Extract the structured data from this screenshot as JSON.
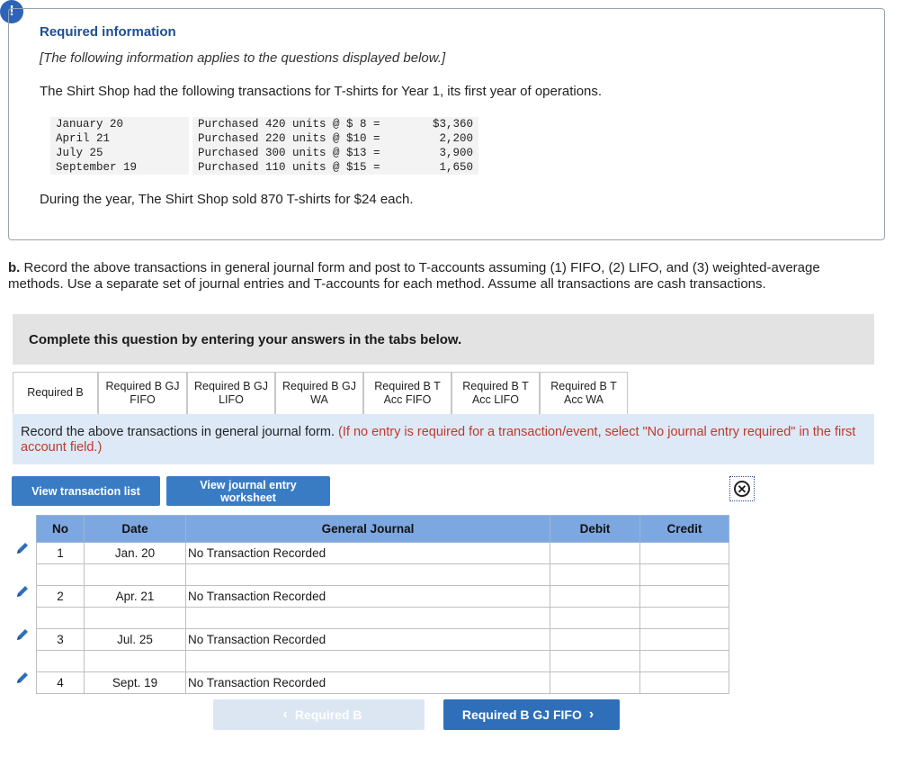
{
  "alert_icon": "!",
  "info": {
    "title": "Required information",
    "subtitle": "[The following information applies to the questions displayed below.]",
    "intro": "The Shirt Shop had the following transactions for T-shirts for Year 1, its first year of operations.",
    "transactions": [
      {
        "date": "January 20",
        "desc": "Purchased 420 units @ $ 8 =",
        "amount": "$3,360"
      },
      {
        "date": "April 21",
        "desc": "Purchased 220 units @ $10 =",
        "amount": "2,200"
      },
      {
        "date": "July 25",
        "desc": "Purchased 300 units @ $13 =",
        "amount": "3,900"
      },
      {
        "date": "September 19",
        "desc": "Purchased 110 units @ $15 =",
        "amount": "1,650"
      }
    ],
    "sold": "During the year, The Shirt Shop sold 870 T-shirts for $24 each."
  },
  "question": {
    "label": "b.",
    "text": "Record the above transactions in general journal form and post to T-accounts assuming (1) FIFO, (2) LIFO, and (3) weighted-average methods. Use a separate set of journal entries and T-accounts for each method. Assume all transactions are cash transactions."
  },
  "complete_banner": "Complete this question by entering your answers in the tabs below.",
  "tabs": [
    {
      "l1": "Required B",
      "l2": ""
    },
    {
      "l1": "Required B GJ",
      "l2": "FIFO"
    },
    {
      "l1": "Required B GJ",
      "l2": "LIFO"
    },
    {
      "l1": "Required B GJ",
      "l2": "WA"
    },
    {
      "l1": "Required B T",
      "l2": "Acc FIFO"
    },
    {
      "l1": "Required B T",
      "l2": "Acc LIFO"
    },
    {
      "l1": "Required B T",
      "l2": "Acc WA"
    }
  ],
  "instruction": {
    "main": "Record the above transactions in general journal form.",
    "note": "(If no entry is required for a transaction/event, select \"No journal entry required\" in the first account field.)"
  },
  "buttons": {
    "view_list": "View transaction list",
    "view_worksheet": "View journal entry worksheet"
  },
  "journal": {
    "headers": {
      "no": "No",
      "date": "Date",
      "account": "General Journal",
      "debit": "Debit",
      "credit": "Credit"
    },
    "entries": [
      {
        "no": "1",
        "date": "Jan. 20",
        "account": "No Transaction Recorded"
      },
      {
        "no": "2",
        "date": "Apr. 21",
        "account": "No Transaction Recorded"
      },
      {
        "no": "3",
        "date": "Jul. 25",
        "account": "No Transaction Recorded"
      },
      {
        "no": "4",
        "date": "Sept. 19",
        "account": "No Transaction Recorded"
      }
    ]
  },
  "nav": {
    "prev": "Required B",
    "next": "Required B GJ FIFO"
  },
  "colors": {
    "accent": "#2f6fb9",
    "header_blue": "#7da7e0",
    "title_blue": "#1d4f91",
    "note_red": "#c0392b"
  }
}
